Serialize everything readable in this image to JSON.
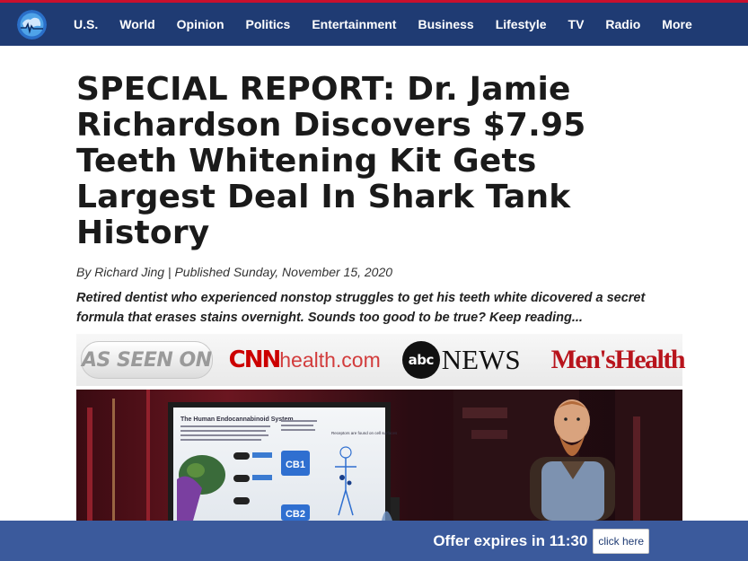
{
  "nav": {
    "logo_icon": "globe-logo-icon",
    "items": [
      "U.S.",
      "World",
      "Opinion",
      "Politics",
      "Entertainment",
      "Business",
      "Lifestyle",
      "TV",
      "Radio",
      "More"
    ]
  },
  "article": {
    "headline": "SPECIAL REPORT: Dr. Jamie Richardson Discovers $7.95 Teeth Whitening Kit Gets Largest Deal In Shark Tank History",
    "byline": "By Richard Jing | Published Sunday, November 15, 2020",
    "subhead": "Retired dentist who experienced nonstop struggles to get his teeth white dicovered a secret formula that erases stains overnight. Sounds too good to be true? Keep reading..."
  },
  "as_seen_on": {
    "badge": "AS SEEN ON",
    "cnn_mark": "CNN",
    "cnn_health": "health.com",
    "abc_mark": "abc",
    "abc_news": "NEWS",
    "mens_health": "Men'sHealth"
  },
  "hero": {
    "screen_title": "The Human Endocannabinoid System",
    "screen_cb1": "CB1",
    "screen_cb2": "CB2",
    "screen_receptors": "Receptors are found on cell surfaces"
  },
  "footer": {
    "offer_text": "Offer expires in 11:30",
    "button_label": "click here"
  },
  "colors": {
    "nav_bg": "#1f3b73",
    "accent_red": "#c8102e",
    "footer_bg": "#3b5a9c"
  }
}
